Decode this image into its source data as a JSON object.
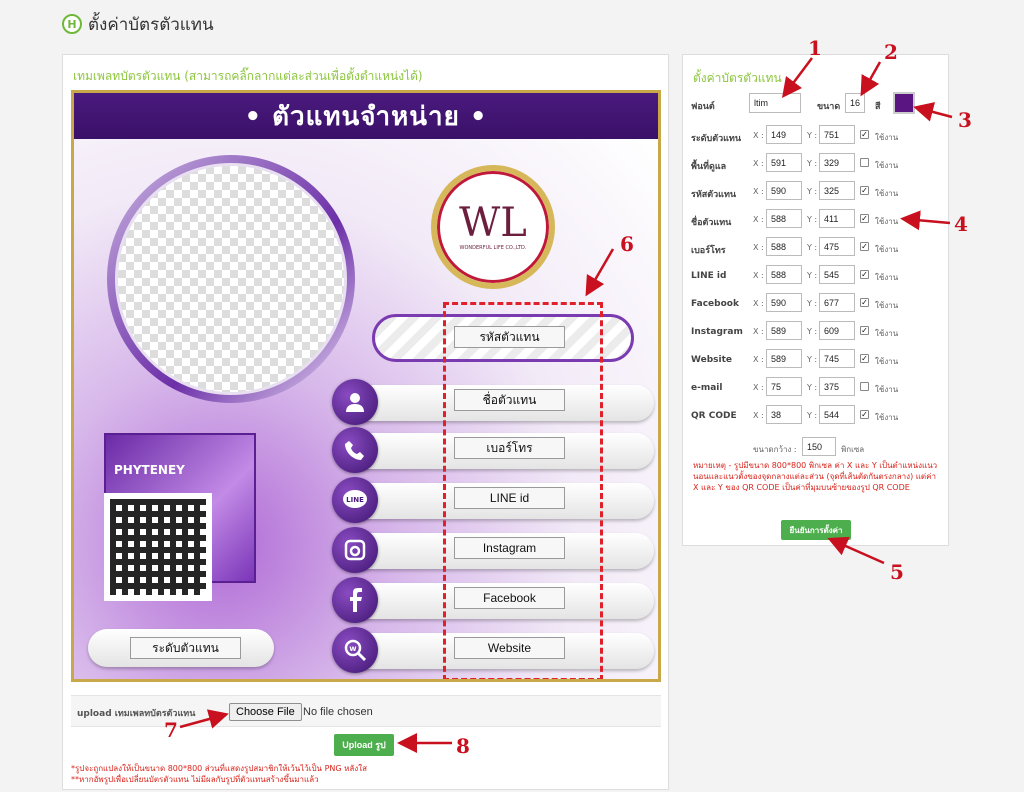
{
  "header": {
    "logo": "H",
    "title": "ตั้งค่าบัตรตัวแทน"
  },
  "left": {
    "title": "เทมเพลทบัตรตัวแทน (สามารถคลิ๊กลากแต่ละส่วนเพื่อตั้งตำแหน่งได้)",
    "card": {
      "header_title": "• ตัวแทนจำหน่าย •",
      "logo_text": "WL",
      "logo_sub": "WONDERFUL LIFE CO.,LTD.",
      "product_label": "PHYTENEY",
      "fields": {
        "agent_code": "รหัสตัวแทน",
        "agent_name": "ชื่อตัวแทน",
        "phone": "เบอร์โทร",
        "line": "LINE id",
        "instagram": "Instagram",
        "facebook": "Facebook",
        "website": "Website",
        "level": "ระดับตัวแทน"
      }
    },
    "upload": {
      "label": "upload เทมเพลทบัตรตัวแทน",
      "choose_file": "Choose File",
      "no_file": "No file chosen",
      "button": "Upload รูป"
    },
    "notes": [
      "*รูปจะถูกแปลงให้เป็นขนาด 800*800 ส่วนที่แสดงรูปสมาชิกให้เว้นไว้เป็น PNG หลังใส",
      "**หากอัพรูปเพื่อเปลี่ยนบัตรตัวแทน ไม่มีผลกับรูปที่ตัวแทนสร้างขึ้นมาแล้ว"
    ]
  },
  "right": {
    "title": "ตั้งค่าบัตรตัวแทน",
    "font_label": "ฟอนต์",
    "font_value": "ltim",
    "size_label": "ขนาด",
    "size_value": "16",
    "color_label": "สี",
    "color": "#5b1582",
    "x_label": "X :",
    "y_label": "Y :",
    "use_label": "ใช้งาน",
    "rows": [
      {
        "label": "ระดับตัวแทน",
        "x": "149",
        "y": "751",
        "checked": true
      },
      {
        "label": "พื้นที่ดูแล",
        "x": "591",
        "y": "329",
        "checked": false
      },
      {
        "label": "รหัสตัวแทน",
        "x": "590",
        "y": "325",
        "checked": true
      },
      {
        "label": "ชื่อตัวแทน",
        "x": "588",
        "y": "411",
        "checked": true
      },
      {
        "label": "เบอร์โทร",
        "x": "588",
        "y": "475",
        "checked": true
      },
      {
        "label": "LINE id",
        "x": "588",
        "y": "545",
        "checked": true
      },
      {
        "label": "Facebook",
        "x": "590",
        "y": "677",
        "checked": true
      },
      {
        "label": "Instagram",
        "x": "589",
        "y": "609",
        "checked": true
      },
      {
        "label": "Website",
        "x": "589",
        "y": "745",
        "checked": true
      },
      {
        "label": "e-mail",
        "x": "75",
        "y": "375",
        "checked": false
      },
      {
        "label": "QR CODE",
        "x": "38",
        "y": "544",
        "checked": true
      }
    ],
    "width_label": "ขนาดกว้าง :",
    "width_value": "150",
    "width_unit": "พิกเซล",
    "note": "หมายเหตุ - รูปมีขนาด 800*800 พิกเซล ค่า X และ Y เป็นตำแหน่งแนวนอนและแนวตั้งของจุดกลางแต่ละส่วน (จุดที่เส้นตัดกันตรงกลาง) แต่ค่า X และ Y ของ QR CODE เป็นค่าที่มุมบนซ้ายของรูป QR CODE",
    "confirm_button": "ยืนยันการตั้งค่า"
  },
  "annotations": [
    "1",
    "2",
    "3",
    "4",
    "5",
    "6",
    "7",
    "8"
  ],
  "icons": [
    "user-icon",
    "phone-icon",
    "line-icon",
    "instagram-icon",
    "facebook-icon",
    "website-icon"
  ]
}
